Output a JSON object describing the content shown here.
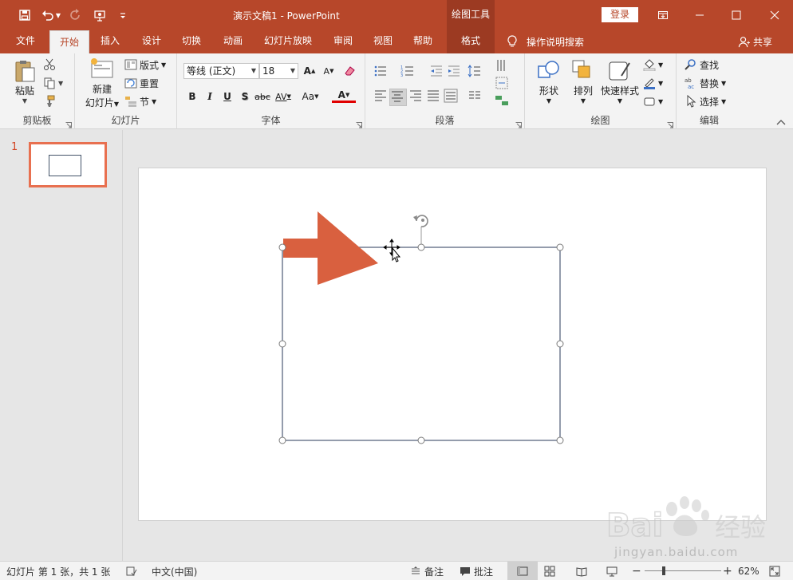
{
  "window": {
    "title": "演示文稿1  -  PowerPoint",
    "context_tab_title": "绘图工具",
    "signin_label": "登录"
  },
  "tabs": {
    "items": [
      "文件",
      "开始",
      "插入",
      "设计",
      "切换",
      "动画",
      "幻灯片放映",
      "审阅",
      "视图",
      "帮助",
      "格式"
    ],
    "active": "开始",
    "tellme": "操作说明搜索",
    "share": "共享"
  },
  "ribbon": {
    "clipboard": {
      "label": "剪贴板",
      "paste": "粘贴"
    },
    "slides": {
      "label": "幻灯片",
      "new_slide_line1": "新建",
      "new_slide_line2": "幻灯片",
      "layout": "版式",
      "reset": "重置",
      "section": "节"
    },
    "font": {
      "label": "字体",
      "font_name": "等线 (正文)",
      "font_size": "18",
      "bold": "B",
      "italic": "I",
      "underline": "U",
      "shadow": "S",
      "strike": "abc",
      "spacing": "AV",
      "case": "Aa",
      "color": "A"
    },
    "paragraph": {
      "label": "段落"
    },
    "drawing": {
      "label": "绘图",
      "shapes": "形状",
      "arrange": "排列",
      "quick_styles": "快速样式"
    },
    "editing": {
      "label": "编辑",
      "find": "查找",
      "replace": "替换",
      "select": "选择"
    }
  },
  "thumbnails": {
    "slide_number": "1"
  },
  "status": {
    "slide_info": "幻灯片 第 1 张，共 1 张",
    "language": "中文(中国)",
    "notes": "备注",
    "comments": "批注",
    "zoom": "62%"
  },
  "watermark": {
    "brand": "Baidu经验",
    "url": "jingyan.baidu.com"
  },
  "colors": {
    "accent": "#b7472a",
    "arrow": "#d9603f",
    "handle_border": "#7a7a7a"
  }
}
